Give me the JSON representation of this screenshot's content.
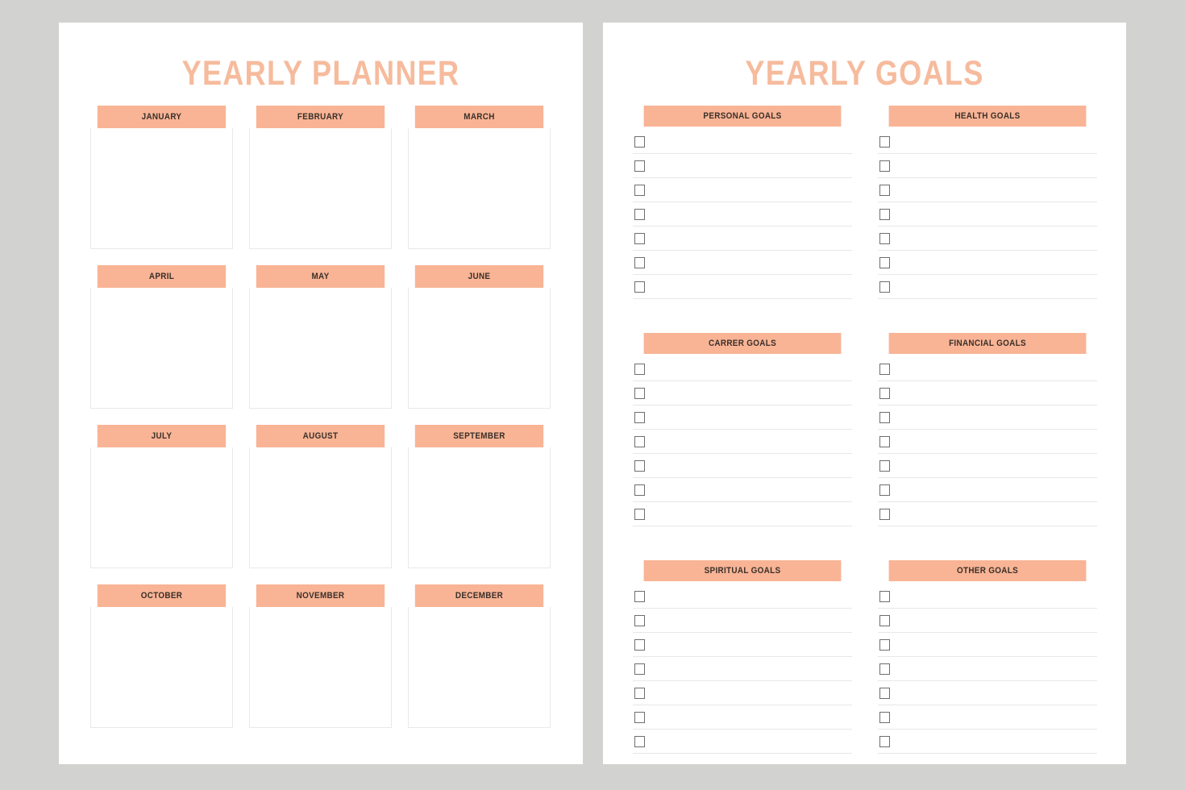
{
  "background_color": "#d2d2d0",
  "accent_color": "#f8b495",
  "title_color": "#f6bb9d",
  "header_text_color": "#3a2f29",
  "left_page": {
    "title": "YEARLY PLANNER",
    "months": [
      {
        "label": "JANUARY"
      },
      {
        "label": "FEBRUARY"
      },
      {
        "label": "MARCH"
      },
      {
        "label": "APRIL"
      },
      {
        "label": "MAY"
      },
      {
        "label": "JUNE"
      },
      {
        "label": "JULY"
      },
      {
        "label": "AUGUST"
      },
      {
        "label": "SEPTEMBER"
      },
      {
        "label": "OCTOBER"
      },
      {
        "label": "NOVEMBER"
      },
      {
        "label": "DECEMBER"
      }
    ]
  },
  "right_page": {
    "title": "YEARLY GOALS",
    "rows_per_block": 7,
    "blocks": [
      {
        "label": "PERSONAL GOALS",
        "items": [
          "",
          "",
          "",
          "",
          "",
          "",
          ""
        ]
      },
      {
        "label": "HEALTH GOALS",
        "items": [
          "",
          "",
          "",
          "",
          "",
          "",
          ""
        ]
      },
      {
        "label": "CARRER GOALS",
        "items": [
          "",
          "",
          "",
          "",
          "",
          "",
          ""
        ]
      },
      {
        "label": "FINANCIAL GOALS",
        "items": [
          "",
          "",
          "",
          "",
          "",
          "",
          ""
        ]
      },
      {
        "label": "SPIRITUAL GOALS",
        "items": [
          "",
          "",
          "",
          "",
          "",
          "",
          ""
        ]
      },
      {
        "label": "OTHER GOALS",
        "items": [
          "",
          "",
          "",
          "",
          "",
          "",
          ""
        ]
      }
    ]
  }
}
